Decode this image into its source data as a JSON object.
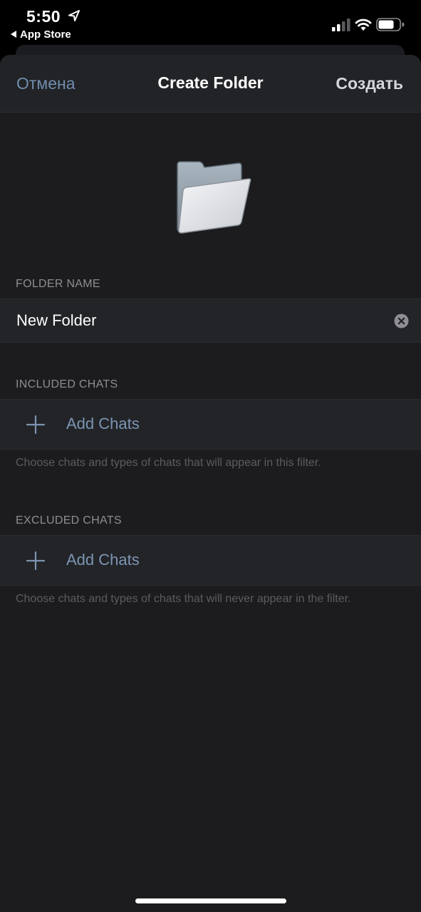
{
  "status_bar": {
    "time": "5:50",
    "back_app": "App Store",
    "icons": [
      "location-arrow-icon",
      "signal-icon",
      "wifi-icon",
      "battery-icon"
    ]
  },
  "nav": {
    "cancel": "Отмена",
    "title": "Create Folder",
    "create": "Создать"
  },
  "folder_name": {
    "header": "FOLDER NAME",
    "value": "New Folder"
  },
  "included": {
    "header": "INCLUDED CHATS",
    "add_label": "Add Chats",
    "footer": "Choose chats and types of chats that will appear in this filter."
  },
  "excluded": {
    "header": "EXCLUDED CHATS",
    "add_label": "Add Chats",
    "footer": "Choose chats and types of chats that will never appear in the filter."
  },
  "colors": {
    "accent": "#708cae",
    "background": "#1c1c1e",
    "row": "#232428"
  }
}
